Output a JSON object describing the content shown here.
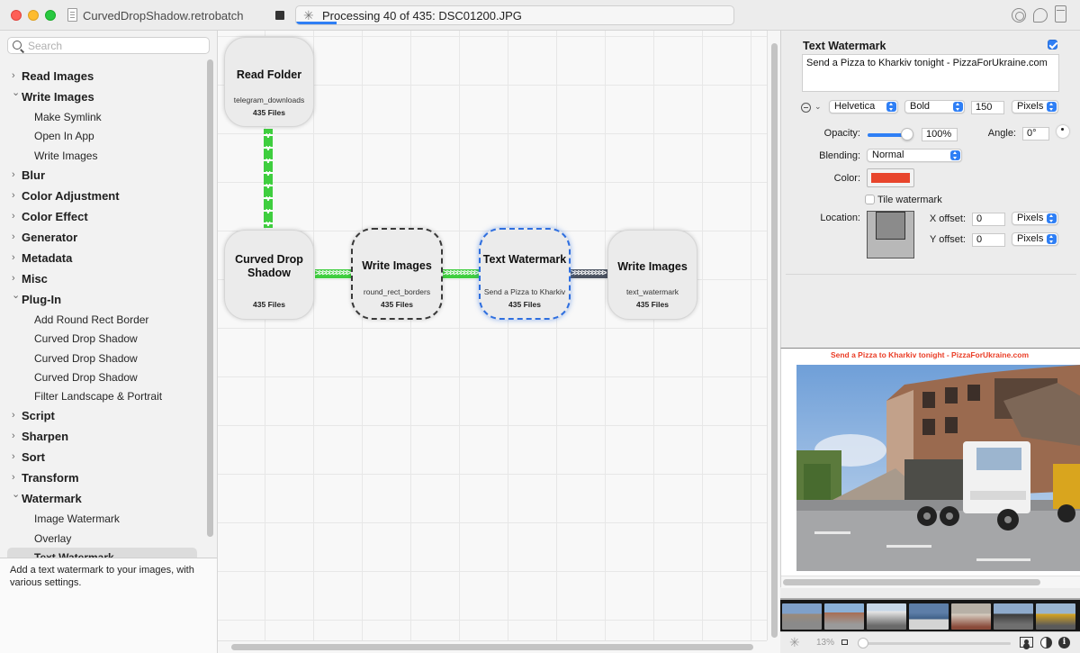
{
  "window": {
    "title": "CurvedDropShadow.retrobatch",
    "progress_text": "Processing 40 of 435: DSC01200.JPG",
    "progress_fraction": 0.092
  },
  "sidebar": {
    "search_placeholder": "Search",
    "categories": [
      {
        "label": "Read Images",
        "expanded": false
      },
      {
        "label": "Write Images",
        "expanded": true,
        "children": [
          "Make Symlink",
          "Open In App",
          "Write Images"
        ]
      },
      {
        "label": "Blur",
        "expanded": false
      },
      {
        "label": "Color Adjustment",
        "expanded": false
      },
      {
        "label": "Color Effect",
        "expanded": false
      },
      {
        "label": "Generator",
        "expanded": false
      },
      {
        "label": "Metadata",
        "expanded": false
      },
      {
        "label": "Misc",
        "expanded": false
      },
      {
        "label": "Plug-In",
        "expanded": true,
        "children": [
          "Add Round Rect Border",
          "Curved Drop Shadow",
          "Curved Drop Shadow",
          "Curved Drop Shadow",
          "Filter Landscape & Portrait"
        ]
      },
      {
        "label": "Script",
        "expanded": false
      },
      {
        "label": "Sharpen",
        "expanded": false
      },
      {
        "label": "Sort",
        "expanded": false
      },
      {
        "label": "Transform",
        "expanded": false
      },
      {
        "label": "Watermark",
        "expanded": true,
        "children": [
          "Image Watermark",
          "Overlay",
          "Text Watermark"
        ]
      }
    ],
    "selected_item": "Text Watermark",
    "description": "Add a text watermark to your images, with various settings."
  },
  "canvas": {
    "nodes": {
      "read_folder": {
        "title": "Read Folder",
        "subtitle": "telegram_downloads",
        "files": "435 Files"
      },
      "curved_drop_shadow": {
        "title": "Curved Drop Shadow",
        "subtitle": "",
        "files": "435 Files"
      },
      "write_images_1": {
        "title": "Write Images",
        "subtitle": "round_rect_borders",
        "files": "435 Files"
      },
      "text_watermark": {
        "title": "Text Watermark",
        "subtitle": "Send a Pizza to Kharkiv",
        "files": "435 Files"
      },
      "write_images_2": {
        "title": "Write Images",
        "subtitle": "text_watermark",
        "files": "435 Files"
      }
    },
    "connector_colors": {
      "active": "#3fce3f",
      "pending": "#4b5361"
    }
  },
  "inspector": {
    "title": "Text Watermark",
    "enabled": true,
    "text": "Send a Pizza to Kharkiv tonight - PizzaForUkraine.com",
    "font": "Helvetica",
    "weight": "Bold",
    "size": "150",
    "size_unit": "Pixels",
    "opacity_label": "Opacity:",
    "opacity_value": "100%",
    "opacity_fraction": 1.0,
    "angle_label": "Angle:",
    "angle_value": "0°",
    "blending_label": "Blending:",
    "blending_value": "Normal",
    "color_label": "Color:",
    "color_value": "#e8452c",
    "tile_label": "Tile watermark",
    "tile_checked": false,
    "location_label": "Location:",
    "x_offset_label": "X offset:",
    "x_offset_value": "0",
    "x_offset_unit": "Pixels",
    "y_offset_label": "Y offset:",
    "y_offset_value": "0",
    "y_offset_unit": "Pixels"
  },
  "preview": {
    "caption": "Send a Pizza to Kharkiv tonight - PizzaForUkraine.com",
    "zoom": "13%"
  }
}
